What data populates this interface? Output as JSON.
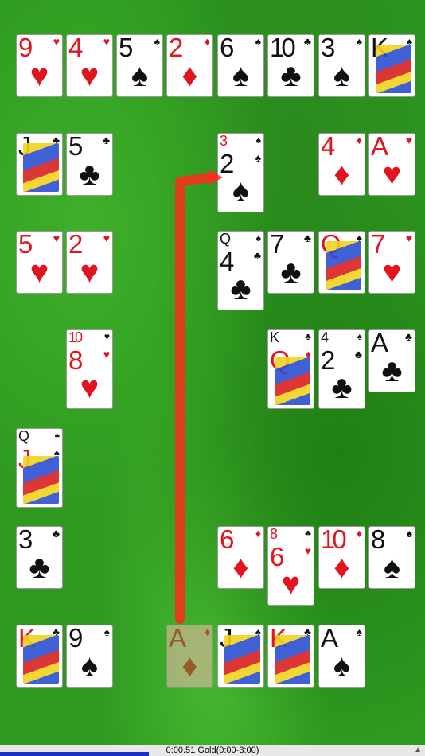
{
  "cards": [
    {
      "rank": "9",
      "suit": "♥",
      "color": "red",
      "face": false
    },
    {
      "rank": "4",
      "suit": "♥",
      "color": "red",
      "face": false
    },
    {
      "rank": "5",
      "suit": "♠",
      "color": "black",
      "face": false
    },
    {
      "rank": "2",
      "suit": "♦",
      "color": "red",
      "face": false
    },
    {
      "rank": "6",
      "suit": "♠",
      "color": "black",
      "face": false
    },
    {
      "rank": "10",
      "suit": "♣",
      "color": "black",
      "face": false
    },
    {
      "rank": "3",
      "suit": "♠",
      "color": "black",
      "face": false
    },
    {
      "rank": "K",
      "suit": "♠",
      "color": "black",
      "face": true
    },
    {
      "rank": "J",
      "suit": "♣",
      "color": "black",
      "face": true
    },
    {
      "rank": "5",
      "suit": "♣",
      "color": "black",
      "face": false
    },
    {
      "rank": "2",
      "suit": "♠",
      "color": "black",
      "face": false,
      "under": {
        "rank": "3",
        "suit": "♠",
        "color": "red"
      }
    },
    {
      "rank": "4",
      "suit": "♦",
      "color": "red",
      "face": false
    },
    {
      "rank": "A",
      "suit": "♥",
      "color": "red",
      "face": false
    },
    {
      "rank": "5",
      "suit": "♥",
      "color": "red",
      "face": false
    },
    {
      "rank": "2",
      "suit": "♥",
      "color": "red",
      "face": false
    },
    {
      "rank": "4",
      "suit": "♣",
      "color": "black",
      "face": false,
      "under": {
        "rank": "Q",
        "suit": "♠",
        "color": "black"
      }
    },
    {
      "rank": "7",
      "suit": "♣",
      "color": "black",
      "face": false
    },
    {
      "rank": "Q",
      "suit": "♠",
      "color": "red",
      "face": true
    },
    {
      "rank": "7",
      "suit": "♥",
      "color": "red",
      "face": false
    },
    {
      "rank": "8",
      "suit": "♥",
      "color": "red",
      "face": false,
      "under": {
        "rank": "10",
        "suit": "♥",
        "color": "red"
      }
    },
    {
      "rank": "Q",
      "suit": "♦",
      "color": "red",
      "face": true,
      "under": {
        "rank": "K",
        "suit": "♣",
        "color": "black"
      }
    },
    {
      "rank": "2",
      "suit": "♣",
      "color": "black",
      "face": false,
      "under": {
        "rank": "4",
        "suit": "♠",
        "color": "black"
      }
    },
    {
      "rank": "A",
      "suit": "♣",
      "color": "black",
      "face": false
    },
    {
      "rank": "J",
      "suit": "♠",
      "color": "red",
      "face": true,
      "under": {
        "rank": "Q",
        "suit": "♠",
        "color": "black"
      }
    },
    {
      "rank": "3",
      "suit": "♣",
      "color": "black",
      "face": false
    },
    {
      "rank": "6",
      "suit": "♦",
      "color": "red",
      "face": false
    },
    {
      "rank": "6",
      "suit": "♥",
      "color": "red",
      "face": false,
      "under": {
        "rank": "8",
        "suit": "♣",
        "color": "red"
      }
    },
    {
      "rank": "10",
      "suit": "♦",
      "color": "red",
      "face": false
    },
    {
      "rank": "8",
      "suit": "♠",
      "color": "black",
      "face": false
    },
    {
      "rank": "K",
      "suit": "♣",
      "color": "red",
      "face": true
    },
    {
      "rank": "9",
      "suit": "♠",
      "color": "black",
      "face": false
    },
    {
      "rank": "A",
      "suit": "♦",
      "color": "red",
      "face": false,
      "ghost": true
    },
    {
      "rank": "J",
      "suit": "♠",
      "color": "black",
      "face": true
    },
    {
      "rank": "K",
      "suit": "♣",
      "color": "red",
      "face": true
    },
    {
      "rank": "A",
      "suit": "♠",
      "color": "black",
      "face": false
    }
  ],
  "status": {
    "text": "0:00.51 Gold(0:00-3:00)",
    "progress": 0.35,
    "icon": "warning-icon"
  },
  "colors": {
    "felt": "#2e9820",
    "hint_arrow": "#ff2a1a",
    "progress_bar": "#1a2fc8"
  }
}
